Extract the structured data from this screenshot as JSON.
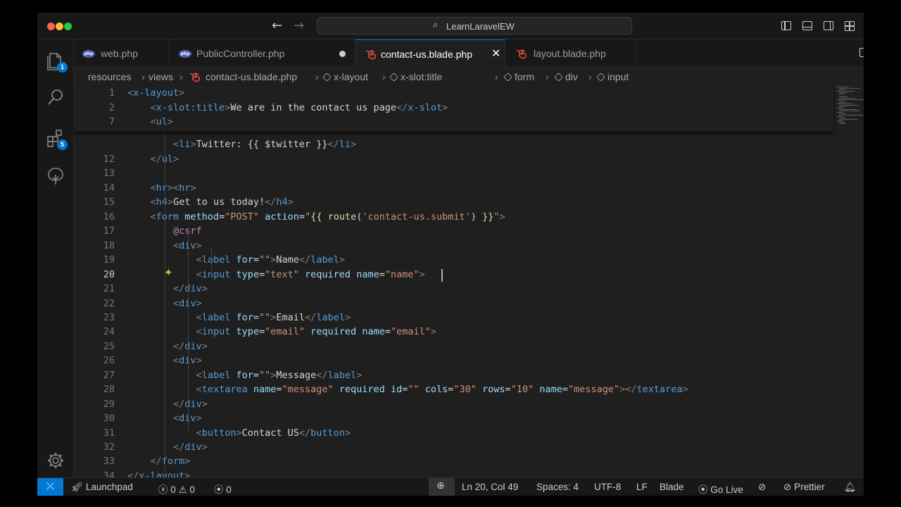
{
  "window": {
    "search_text": "LearnLaravelEW"
  },
  "activity": {
    "explorer_badge": "1",
    "extensions_badge": "5"
  },
  "tabs": [
    {
      "label": "web.php"
    },
    {
      "label": "PublicController.php"
    },
    {
      "label": "contact-us.blade.php"
    },
    {
      "label": "layout.blade.php"
    }
  ],
  "breadcrumb": {
    "items": [
      "resources",
      "views",
      "contact-us.blade.php",
      "x-layout",
      "x-slot:title",
      "form",
      "div",
      "input"
    ],
    "separator": "›"
  },
  "editor": {
    "sticky": [
      {
        "n": "1",
        "tokens": [
          [
            "t",
            "<"
          ],
          [
            "tg",
            "x-layout"
          ],
          [
            "t",
            ">"
          ]
        ]
      },
      {
        "n": "2",
        "tokens": [
          [
            "tx",
            "    "
          ],
          [
            "t",
            "<"
          ],
          [
            "tg",
            "x-slot:title"
          ],
          [
            "t",
            ">"
          ],
          [
            "tx",
            "We are in the contact us page"
          ],
          [
            "t",
            "</"
          ],
          [
            "tg",
            "x-slot"
          ],
          [
            "t",
            ">"
          ]
        ]
      },
      {
        "n": "7",
        "tokens": [
          [
            "tx",
            "    "
          ],
          [
            "t",
            "<"
          ],
          [
            "tg",
            "ul"
          ],
          [
            "t",
            ">"
          ]
        ]
      }
    ],
    "partial": {
      "tokens": [
        [
          "tx",
          "        "
        ],
        [
          "t",
          "<"
        ],
        [
          "tg",
          "li"
        ],
        [
          "t",
          ">"
        ],
        [
          "tx",
          "Twitter: "
        ],
        [
          "bl",
          "{{ "
        ],
        [
          "tx",
          "$twitter "
        ],
        [
          "bl",
          "}}"
        ],
        [
          "t",
          "</"
        ],
        [
          "tg",
          "li"
        ],
        [
          "t",
          ">"
        ]
      ]
    },
    "lines": [
      {
        "n": "12",
        "tokens": [
          [
            "tx",
            "    "
          ],
          [
            "t",
            "</"
          ],
          [
            "tg",
            "ul"
          ],
          [
            "t",
            ">"
          ]
        ]
      },
      {
        "n": "13",
        "tokens": []
      },
      {
        "n": "14",
        "tokens": [
          [
            "tx",
            "    "
          ],
          [
            "t",
            "<"
          ],
          [
            "tg",
            "hr"
          ],
          [
            "t",
            "><"
          ],
          [
            "tg",
            "hr"
          ],
          [
            "t",
            ">"
          ]
        ]
      },
      {
        "n": "15",
        "tokens": [
          [
            "tx",
            "    "
          ],
          [
            "t",
            "<"
          ],
          [
            "tg",
            "h4"
          ],
          [
            "t",
            ">"
          ],
          [
            "tx",
            "Get to us today!"
          ],
          [
            "t",
            "</"
          ],
          [
            "tg",
            "h4"
          ],
          [
            "t",
            ">"
          ]
        ]
      },
      {
        "n": "16",
        "tokens": [
          [
            "tx",
            "    "
          ],
          [
            "t",
            "<"
          ],
          [
            "tg",
            "form "
          ],
          [
            "at",
            "method"
          ],
          [
            "tx",
            "="
          ],
          [
            "st",
            "\"POST\" "
          ],
          [
            "at",
            "action"
          ],
          [
            "tx",
            "="
          ],
          [
            "st",
            "\""
          ],
          [
            "bl",
            "{{ "
          ],
          [
            "bl",
            "route"
          ],
          [
            "tx",
            "("
          ],
          [
            "st",
            "'contact-us.submit'"
          ],
          [
            "tx",
            ") "
          ],
          [
            "bl",
            "}}"
          ],
          [
            "st",
            "\""
          ],
          [
            "t",
            ">"
          ]
        ]
      },
      {
        "n": "17",
        "tokens": [
          [
            "tx",
            "        "
          ],
          [
            "cs",
            "@csrf"
          ]
        ]
      },
      {
        "n": "18",
        "tokens": [
          [
            "tx",
            "        "
          ],
          [
            "t",
            "<"
          ],
          [
            "tg",
            "div"
          ],
          [
            "t",
            ">"
          ]
        ]
      },
      {
        "n": "19",
        "tokens": [
          [
            "tx",
            "            "
          ],
          [
            "t",
            "<"
          ],
          [
            "tg",
            "label "
          ],
          [
            "at",
            "for"
          ],
          [
            "tx",
            "="
          ],
          [
            "st",
            "\"\""
          ],
          [
            "t",
            ">"
          ],
          [
            "tx",
            "Name"
          ],
          [
            "t",
            "</"
          ],
          [
            "tg",
            "label"
          ],
          [
            "t",
            ">"
          ]
        ]
      },
      {
        "n": "20",
        "tokens": [
          [
            "tx",
            "            "
          ],
          [
            "t",
            "<"
          ],
          [
            "tg",
            "input "
          ],
          [
            "at",
            "type"
          ],
          [
            "tx",
            "="
          ],
          [
            "st",
            "\"text\" "
          ],
          [
            "at",
            "required "
          ],
          [
            "at",
            "name"
          ],
          [
            "tx",
            "="
          ],
          [
            "st",
            "\"name\""
          ],
          [
            "t",
            ">"
          ]
        ]
      },
      {
        "n": "21",
        "tokens": [
          [
            "tx",
            "        "
          ],
          [
            "t",
            "</"
          ],
          [
            "tg",
            "div"
          ],
          [
            "t",
            ">"
          ]
        ]
      },
      {
        "n": "22",
        "tokens": [
          [
            "tx",
            "        "
          ],
          [
            "t",
            "<"
          ],
          [
            "tg",
            "div"
          ],
          [
            "t",
            ">"
          ]
        ]
      },
      {
        "n": "23",
        "tokens": [
          [
            "tx",
            "            "
          ],
          [
            "t",
            "<"
          ],
          [
            "tg",
            "label "
          ],
          [
            "at",
            "for"
          ],
          [
            "tx",
            "="
          ],
          [
            "st",
            "\"\""
          ],
          [
            "t",
            ">"
          ],
          [
            "tx",
            "Email"
          ],
          [
            "t",
            "</"
          ],
          [
            "tg",
            "label"
          ],
          [
            "t",
            ">"
          ]
        ]
      },
      {
        "n": "24",
        "tokens": [
          [
            "tx",
            "            "
          ],
          [
            "t",
            "<"
          ],
          [
            "tg",
            "input "
          ],
          [
            "at",
            "type"
          ],
          [
            "tx",
            "="
          ],
          [
            "st",
            "\"email\" "
          ],
          [
            "at",
            "required "
          ],
          [
            "at",
            "name"
          ],
          [
            "tx",
            "="
          ],
          [
            "st",
            "\"email\""
          ],
          [
            "t",
            ">"
          ]
        ]
      },
      {
        "n": "25",
        "tokens": [
          [
            "tx",
            "        "
          ],
          [
            "t",
            "</"
          ],
          [
            "tg",
            "div"
          ],
          [
            "t",
            ">"
          ]
        ]
      },
      {
        "n": "26",
        "tokens": [
          [
            "tx",
            "        "
          ],
          [
            "t",
            "<"
          ],
          [
            "tg",
            "div"
          ],
          [
            "t",
            ">"
          ]
        ]
      },
      {
        "n": "27",
        "tokens": [
          [
            "tx",
            "            "
          ],
          [
            "t",
            "<"
          ],
          [
            "tg",
            "label "
          ],
          [
            "at",
            "for"
          ],
          [
            "tx",
            "="
          ],
          [
            "st",
            "\"\""
          ],
          [
            "t",
            ">"
          ],
          [
            "tx",
            "Message"
          ],
          [
            "t",
            "</"
          ],
          [
            "tg",
            "label"
          ],
          [
            "t",
            ">"
          ]
        ]
      },
      {
        "n": "28",
        "tokens": [
          [
            "tx",
            "            "
          ],
          [
            "t",
            "<"
          ],
          [
            "tg",
            "textarea "
          ],
          [
            "at",
            "name"
          ],
          [
            "tx",
            "="
          ],
          [
            "st",
            "\"message\" "
          ],
          [
            "at",
            "required "
          ],
          [
            "at",
            "id"
          ],
          [
            "tx",
            "="
          ],
          [
            "st",
            "\"\" "
          ],
          [
            "at",
            "cols"
          ],
          [
            "tx",
            "="
          ],
          [
            "st",
            "\"30\" "
          ],
          [
            "at",
            "rows"
          ],
          [
            "tx",
            "="
          ],
          [
            "st",
            "\"10\" "
          ],
          [
            "at",
            "name"
          ],
          [
            "tx",
            "="
          ],
          [
            "st",
            "\"message\""
          ],
          [
            "t",
            "></"
          ],
          [
            "tg",
            "textarea"
          ],
          [
            "t",
            ">"
          ]
        ]
      },
      {
        "n": "29",
        "tokens": [
          [
            "tx",
            "        "
          ],
          [
            "t",
            "</"
          ],
          [
            "tg",
            "div"
          ],
          [
            "t",
            ">"
          ]
        ]
      },
      {
        "n": "30",
        "tokens": [
          [
            "tx",
            "        "
          ],
          [
            "t",
            "<"
          ],
          [
            "tg",
            "div"
          ],
          [
            "t",
            ">"
          ]
        ]
      },
      {
        "n": "31",
        "tokens": [
          [
            "tx",
            "            "
          ],
          [
            "t",
            "<"
          ],
          [
            "tg",
            "button"
          ],
          [
            "t",
            ">"
          ],
          [
            "tx",
            "Contact US"
          ],
          [
            "t",
            "</"
          ],
          [
            "tg",
            "button"
          ],
          [
            "t",
            ">"
          ]
        ]
      },
      {
        "n": "32",
        "tokens": [
          [
            "tx",
            "        "
          ],
          [
            "t",
            "</"
          ],
          [
            "tg",
            "div"
          ],
          [
            "t",
            ">"
          ]
        ]
      },
      {
        "n": "33",
        "tokens": [
          [
            "tx",
            "    "
          ],
          [
            "t",
            "</"
          ],
          [
            "tg",
            "form"
          ],
          [
            "t",
            ">"
          ]
        ]
      },
      {
        "n": "34",
        "tokens": [
          [
            "t",
            "</"
          ],
          [
            "tg",
            "x-layout"
          ],
          [
            "t",
            ">"
          ]
        ]
      }
    ],
    "current_line": "20"
  },
  "status": {
    "launchpad": "Launchpad",
    "errors": "0",
    "warnings": "0",
    "ports": "0",
    "position": "Ln 20, Col 49",
    "spaces": "Spaces: 4",
    "encoding": "UTF-8",
    "eol": "LF",
    "language": "Blade",
    "golive": "Go Live",
    "prettier": "Prettier"
  }
}
